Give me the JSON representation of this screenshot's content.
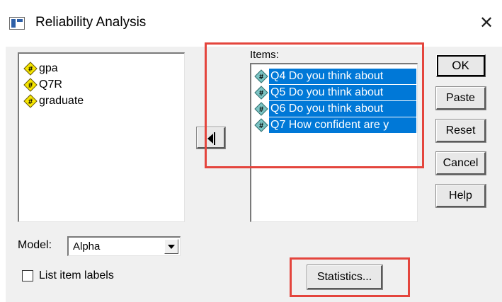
{
  "window": {
    "title": "Reliability Analysis",
    "close_glyph": "✕",
    "icon": "spss-window-icon"
  },
  "source_list": {
    "items": [
      {
        "label": "gpa",
        "icon": "scale-variable-icon"
      },
      {
        "label": "Q7R",
        "icon": "scale-variable-icon"
      },
      {
        "label": "graduate",
        "icon": "scale-variable-icon"
      }
    ]
  },
  "move_button": {
    "icon": "move-left-arrow-icon"
  },
  "items_panel": {
    "label": "Items:",
    "items": [
      {
        "label": "Q4 Do you think about",
        "icon": "scale-variable-icon",
        "selected": true
      },
      {
        "label": "Q5 Do you think about",
        "icon": "scale-variable-icon",
        "selected": true
      },
      {
        "label": "Q6 Do you think about",
        "icon": "scale-variable-icon",
        "selected": true
      },
      {
        "label": "Q7 How confident are y",
        "icon": "scale-variable-icon",
        "selected": true
      }
    ]
  },
  "buttons": {
    "ok": "OK",
    "paste": "Paste",
    "reset": "Reset",
    "cancel": "Cancel",
    "help": "Help",
    "statistics": "Statistics..."
  },
  "model": {
    "label": "Model:",
    "selected": "Alpha"
  },
  "list_item_labels": {
    "label": "List item labels",
    "checked": false
  },
  "colors": {
    "selection": "#0078d7",
    "highlight_box": "#e4453d",
    "dialog_bg": "#f0f0f0"
  }
}
